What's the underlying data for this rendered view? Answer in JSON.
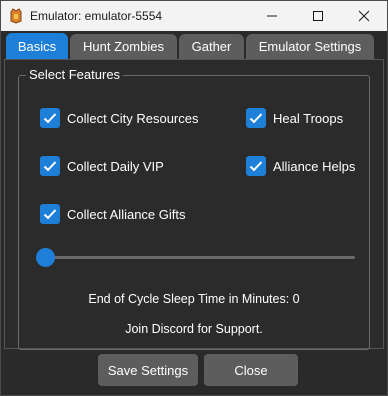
{
  "window": {
    "title": "Emulator: emulator-5554"
  },
  "titlebar_icons": {
    "app": "app-icon",
    "minimize": "minimize-icon",
    "maximize": "maximize-icon",
    "close": "close-icon"
  },
  "tabs": [
    {
      "label": "Basics",
      "active": true
    },
    {
      "label": "Hunt Zombies",
      "active": false
    },
    {
      "label": "Gather",
      "active": false
    },
    {
      "label": "Emulator Settings",
      "active": false
    }
  ],
  "features": {
    "group_title": "Select Features",
    "options": [
      {
        "label": "Collect City Resources",
        "checked": true
      },
      {
        "label": "Collect Daily VIP",
        "checked": true
      },
      {
        "label": "Collect Alliance Gifts",
        "checked": true
      },
      {
        "label": "Heal Troops",
        "checked": true
      },
      {
        "label": "Alliance Helps",
        "checked": true
      }
    ]
  },
  "sleep": {
    "slider_value": 0,
    "label": "End of Cycle Sleep Time in Minutes: 0"
  },
  "support_text": "Join Discord for Support.",
  "buttons": {
    "save": "Save Settings",
    "close": "Close"
  },
  "colors": {
    "accent": "#1e7fd8",
    "background": "#2b2b2b",
    "inactive_tab": "#5d5d5d",
    "titlebar": "#f3f3f3"
  }
}
